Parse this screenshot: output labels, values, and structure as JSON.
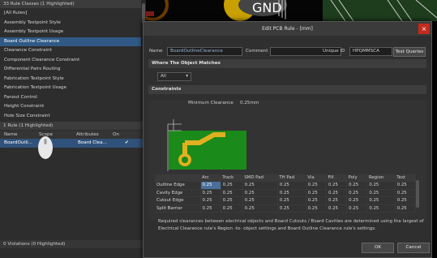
{
  "pcb": {
    "silk_text": "GND"
  },
  "rule_classes": {
    "header": "33 Rule Classes (1 Highlighted)",
    "items": [
      {
        "label": "[All Rules]"
      },
      {
        "label": "Assembly Testpoint Style"
      },
      {
        "label": "Assembly Testpoint Usage"
      },
      {
        "label": "Board Outline Clearance",
        "selected": true
      },
      {
        "label": "Clearance Constraint"
      },
      {
        "label": "Component Clearance Constraint"
      },
      {
        "label": "Differential Pairs Routing"
      },
      {
        "label": "Fabrication Testpoint Style"
      },
      {
        "label": "Fabrication Testpoint Usage"
      },
      {
        "label": "Fanout Control"
      },
      {
        "label": "Height Constraint"
      },
      {
        "label": "Hole Size Constraint"
      }
    ]
  },
  "rules": {
    "header": "1 Rule (1 Highlighted)",
    "columns": {
      "name": "Name",
      "scope": "Scope",
      "attributes": "Attributes",
      "on": "On"
    },
    "row": {
      "name": "BoardOutli...",
      "attributes": "Board Clea...",
      "on": "✔"
    }
  },
  "violations": {
    "header": "0 Violations (0 Highlighted)"
  },
  "dialog": {
    "title": "Edit PCB Rule - [mm]",
    "name_label": "Name",
    "name_value": "BoardOutlineClearance",
    "comment_label": "Comment",
    "comment_value": "",
    "uid_label": "Unique ID",
    "uid_value": "HPQMMSCA",
    "test_queries": "Test Queries",
    "where_header": "Where The Object Matches",
    "where_select": "All",
    "constraints_header": "Constraints",
    "min_clearance_label": "Minimum Clearance",
    "min_clearance_value": "0.25mm",
    "table": {
      "columns": [
        "",
        "Arc",
        "Track",
        "SMD Pad",
        "TH Pad",
        "Via",
        "Fill",
        "Poly",
        "Region",
        "Text"
      ],
      "rows": [
        {
          "name": "Outline Edge",
          "values": [
            "0.25",
            "0.25",
            "0.25",
            "0.25",
            "0.25",
            "0.25",
            "0.25",
            "0.25",
            "0.25"
          ]
        },
        {
          "name": "Cavity Edge",
          "values": [
            "0.25",
            "0.25",
            "0.25",
            "0.25",
            "0.25",
            "0.25",
            "0.25",
            "0.25",
            "0.25"
          ]
        },
        {
          "name": "Cutout Edge",
          "values": [
            "0.25",
            "0.25",
            "0.25",
            "0.25",
            "0.25",
            "0.25",
            "0.25",
            "0.25",
            "0.25"
          ]
        },
        {
          "name": "Split Barrier",
          "values": [
            "0.25",
            "0.25",
            "0.25",
            "0.25",
            "0.25",
            "0.25",
            "0.25",
            "0.25",
            "0.25"
          ]
        }
      ]
    },
    "description": "Required clearances between electrical objects and Board Cutouts / Board Cavities are determined using the largest of Electrical Clearance rule's Region -to- object settings and Board Outline Clearance rule's settings.",
    "ok": "OK",
    "cancel": "Cancel"
  }
}
